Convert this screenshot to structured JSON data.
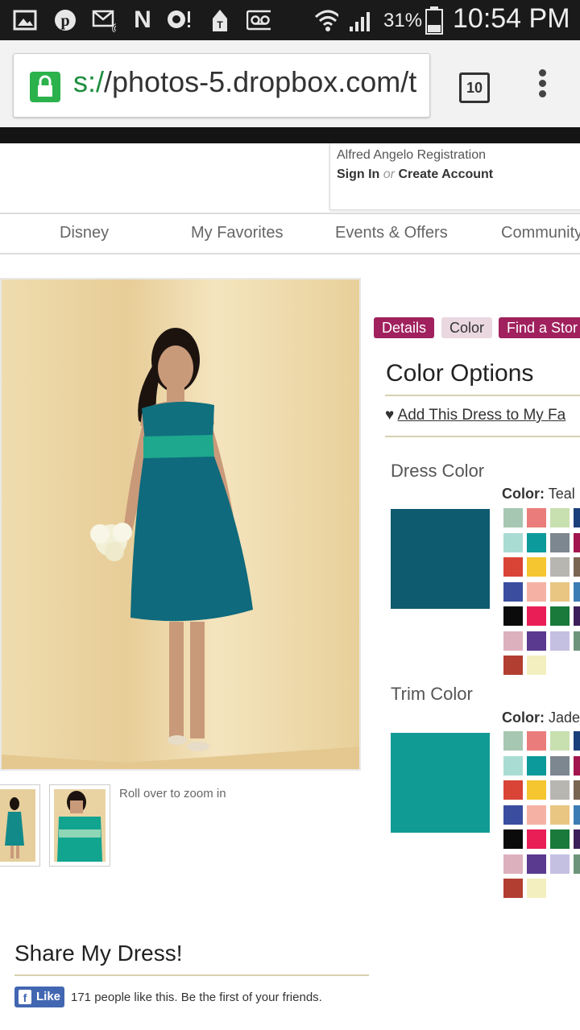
{
  "status_bar": {
    "battery_percent": "31%",
    "time": "10:54 PM",
    "icons": [
      "gallery-icon",
      "pinterest-icon",
      "email-icon",
      "n-icon",
      "chat-icon",
      "tmobile-icon",
      "voicemail-icon",
      "wifi-icon",
      "signal-icon",
      "battery-icon"
    ]
  },
  "browser": {
    "url_scheme": "s:/",
    "url_rest": "/photos-5.dropbox.com/t",
    "tab_count": "10"
  },
  "registration": {
    "title": "Alfred Angelo Registration",
    "sign_in": "Sign In",
    "or": "or",
    "create_account": "Create Account"
  },
  "nav": {
    "items": [
      "Disney",
      "My Favorites",
      "Events & Offers",
      "Community"
    ]
  },
  "product": {
    "rollover_hint": "Roll over to zoom in",
    "tabs": {
      "details": "Details",
      "color": "Color",
      "find_store": "Find a Stor"
    },
    "color_options_title": "Color Options",
    "add_favorites": "Add This Dress to My Fa",
    "dress_color": {
      "label": "Dress Color",
      "color_prefix": "Color:",
      "color_name": "Teal",
      "selected_hex": "#0e5a6e"
    },
    "trim_color": {
      "label": "Trim Color",
      "color_prefix": "Color:",
      "color_name": "Jade",
      "selected_hex": "#109b95"
    },
    "palette": [
      [
        "#a6c7b1",
        "#ea7d7b",
        "#c8e0b0",
        "#1b3f7a"
      ],
      [
        "#a9ddd3",
        "#0c9a9a",
        "#7d8790",
        "#a3154e"
      ],
      [
        "#d94436",
        "#f5c62f",
        "#b8b6b1",
        "#7a6452"
      ],
      [
        "#3a4d9f",
        "#f5b2a4",
        "#e9c782",
        "#3c7cb5"
      ],
      [
        "#0b0b0b",
        "#ea1e57",
        "#1a7a3b",
        "#3c1f5a"
      ],
      [
        "#ddb0bd",
        "#5a3a8f",
        "#c4c0e2",
        "#6e957b"
      ],
      [
        "#b23e31",
        "#f3efbf"
      ]
    ]
  },
  "share": {
    "title": "Share My Dress!",
    "like_label": "Like",
    "like_text": "171 people like this. Be the first of your friends."
  }
}
